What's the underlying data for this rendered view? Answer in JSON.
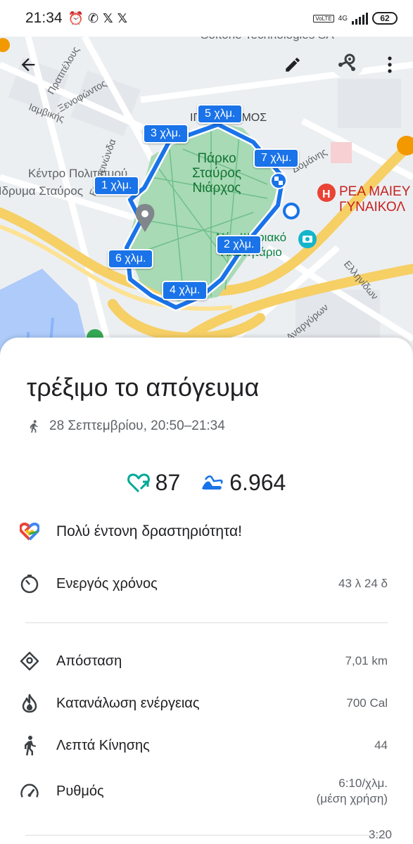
{
  "status_bar": {
    "time": "21:34",
    "lte_label": "VoLTE",
    "network": "4G",
    "battery": "62"
  },
  "map": {
    "labels": {
      "sofone": "Softone Technologies SA",
      "pratitelous": "Πρατιτέλους",
      "xenofontos": "Ξενοφώντος",
      "iamvis": "Ιαμβικής",
      "epameinonda": "Επαμεινώνδα",
      "kentro": "Κέντρο Πολιτισμού",
      "idryma": "Ίδρυμα Σταύρος",
      "ipporamos": "ΙΠΠΟΔΡΟΜΟΣ",
      "park": "Πάρκο Σταύρος Νιάρχος",
      "domanis": "Δομάνης",
      "rea": "ΡΕΑ ΜΑΙΕΥ ΓΥΝΑΙΚΟΛ",
      "planetarium": "Νέο Ψηφιακό Πλανητάριο",
      "ellinidon": "Ελληνίδων",
      "anagyrou": "Αναργύρων"
    },
    "km_markers": [
      "1 χλμ.",
      "2 χλμ.",
      "3 χλμ.",
      "4 χλμ.",
      "5 χλμ.",
      "6 χλμ.",
      "7 χλμ."
    ]
  },
  "activity": {
    "title": "τρέξιμο το απόγευμα",
    "datetime": "28 Σεπτεμβρίου, 20:50–21:34",
    "heart_points": "87",
    "steps": "6.964",
    "intensity_message": "Πολύ έντονη δραστηριότητα!"
  },
  "stats": {
    "active_time_label": "Ενεργός χρόνος",
    "active_time_value": "43 λ 24 δ",
    "distance_label": "Απόσταση",
    "distance_value": "7,01 km",
    "energy_label": "Κατανάλωση ενέργειας",
    "energy_value": "700 Cal",
    "move_minutes_label": "Λεπτά Κίνησης",
    "move_minutes_value": "44",
    "pace_label": "Ρυθμός",
    "pace_value": "6:10/χλμ.",
    "pace_note": "(μέση χρήση)",
    "split_value": "3:20"
  },
  "colors": {
    "route": "#1a73e8",
    "park": "#a8dab5",
    "heart_points": "#00a896",
    "steps": "#1a73e8"
  },
  "icons": {
    "back": "arrow-left-icon",
    "edit": "pencil-icon",
    "share": "route-share-icon",
    "more": "more-vert-icon",
    "walk": "walk-icon",
    "heart": "heart-points-icon",
    "steps": "steps-icon",
    "google_fit": "google-fit-heart-icon",
    "timer": "timer-icon",
    "distance": "distance-pin-icon",
    "fire": "flame-icon",
    "person": "walking-person-icon",
    "speed": "speedometer-icon"
  }
}
